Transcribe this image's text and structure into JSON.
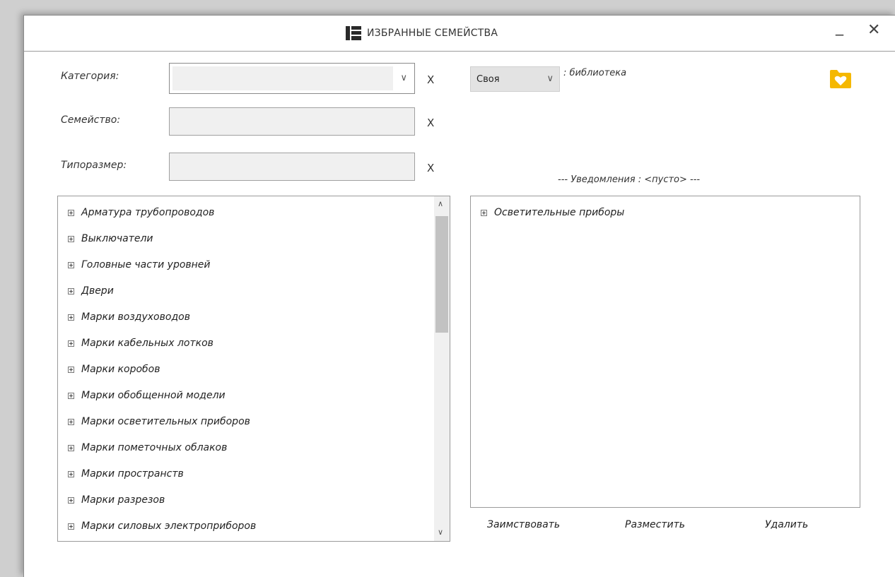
{
  "window": {
    "title": "ИЗБРАННЫЕ СЕМЕЙСТВА",
    "minimize": "_",
    "close": "✕"
  },
  "filters": {
    "category_label": "Категория:",
    "family_label": "Семейство:",
    "typesize_label": "Типоразмер:",
    "category_value": "",
    "family_value": "",
    "typesize_value": "",
    "clear": "X"
  },
  "library": {
    "selected": "Своя",
    "suffix": ": библиотека"
  },
  "notifications": "--- Уведомления : <пусто> ---",
  "left_tree": [
    "Арматура трубопроводов",
    "Выключатели",
    "Головные части уровней",
    "Двери",
    "Марки воздуховодов",
    "Марки кабельных лотков",
    "Марки коробов",
    "Марки обобщенной модели",
    "Марки осветительных приборов",
    "Марки пометочных облаков",
    "Марки пространств",
    "Марки разрезов",
    "Марки силовых электроприборов"
  ],
  "right_tree": [
    "Осветительные приборы"
  ],
  "actions": {
    "borrow": "Заимствовать",
    "place": "Разместить",
    "delete": "Удалить"
  },
  "colors": {
    "folder_icon": "#f5b800",
    "title_icon": "#2a2a2a"
  }
}
